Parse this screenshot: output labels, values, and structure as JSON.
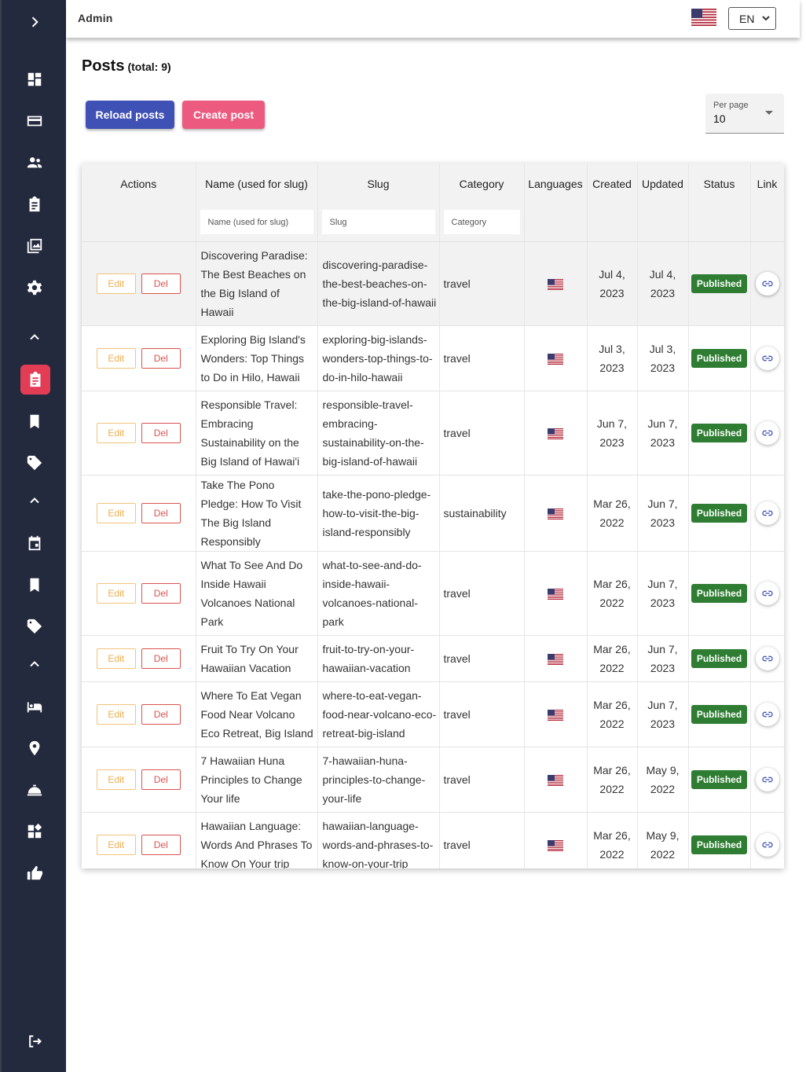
{
  "topbar": {
    "admin_label": "Admin",
    "language": "EN",
    "flag_icon": "us-flag-icon"
  },
  "sidebar": {
    "icons": [
      "chevron-right-icon",
      "dashboard-icon",
      "credit-card-icon",
      "users-icon",
      "clipboard-icon",
      "photo-library-icon",
      "settings-icon",
      "chevron-up-icon",
      "posts-icon",
      "bookmark-icon",
      "tag-icon",
      "chevron-up-icon",
      "calendar-icon",
      "bookmark-icon",
      "tag-icon",
      "chevron-up-icon",
      "bed-icon",
      "location-pin-icon",
      "room-service-icon",
      "widgets-icon",
      "thumb-up-icon",
      "logout-icon"
    ],
    "active": "posts-icon"
  },
  "page": {
    "title": "Posts",
    "total": "(total: 9)",
    "reload_label": "Reload posts",
    "create_label": "Create post",
    "per_page_label": "Per page",
    "per_page_value": "10"
  },
  "table": {
    "headers": {
      "actions": "Actions",
      "name": "Name (used for slug)",
      "slug": "Slug",
      "category": "Category",
      "languages": "Languages",
      "created": "Created",
      "updated": "Updated",
      "status": "Status",
      "link": "Link"
    },
    "filters": {
      "name": "Name (used for slug)",
      "slug": "Slug",
      "category": "Category"
    },
    "edit_label": "Edit",
    "del_label": "Del",
    "rows": [
      {
        "name": "Discovering Paradise: The Best Beaches on the Big Island of Hawaii",
        "slug": "discovering-paradise-the-best-beaches-on-the-big-island-of-hawaii",
        "category": "travel",
        "created_1": "Jul 4,",
        "created_2": "2023",
        "updated_1": "Jul 4,",
        "updated_2": "2023",
        "status": "Published"
      },
      {
        "name": "Exploring Big Island's Wonders: Top Things to Do in Hilo, Hawaii",
        "slug": "exploring-big-islands-wonders-top-things-to-do-in-hilo-hawaii",
        "category": "travel",
        "created_1": "Jul 3,",
        "created_2": "2023",
        "updated_1": "Jul 3,",
        "updated_2": "2023",
        "status": "Published"
      },
      {
        "name": "Responsible Travel: Embracing Sustainability on the Big Island of Hawai'i",
        "slug": "responsible-travel-embracing-sustainability-on-the-big-island-of-hawaii",
        "category": "travel",
        "created_1": "Jun 7,",
        "created_2": "2023",
        "updated_1": "Jun 7,",
        "updated_2": "2023",
        "status": "Published"
      },
      {
        "name": "Take The Pono Pledge: How To Visit The Big Island Responsibly",
        "slug": "take-the-pono-pledge-how-to-visit-the-big-island-responsibly",
        "category": "sustainability",
        "created_1": "Mar 26,",
        "created_2": "2022",
        "updated_1": "Jun 7,",
        "updated_2": "2023",
        "status": "Published"
      },
      {
        "name": "What To See And Do Inside Hawaii Volcanoes National Park",
        "slug": "what-to-see-and-do-inside-hawaii-volcanoes-national-park",
        "category": "travel",
        "created_1": "Mar 26,",
        "created_2": "2022",
        "updated_1": "Jun 7,",
        "updated_2": "2023",
        "status": "Published"
      },
      {
        "name": "Fruit To Try On Your Hawaiian Vacation",
        "slug": "fruit-to-try-on-your-hawaiian-vacation",
        "category": "travel",
        "created_1": "Mar 26,",
        "created_2": "2022",
        "updated_1": "Jun 7,",
        "updated_2": "2023",
        "status": "Published"
      },
      {
        "name": "Where To Eat Vegan Food Near Volcano Eco Retreat, Big Island",
        "slug": "where-to-eat-vegan-food-near-volcano-eco-retreat-big-island",
        "category": "travel",
        "created_1": "Mar 26,",
        "created_2": "2022",
        "updated_1": "Jun 7,",
        "updated_2": "2023",
        "status": "Published"
      },
      {
        "name": "7 Hawaiian Huna Principles to Change Your life",
        "slug": "7-hawaiian-huna-principles-to-change-your-life",
        "category": "travel",
        "created_1": "Mar 26,",
        "created_2": "2022",
        "updated_1": "May 9,",
        "updated_2": "2022",
        "status": "Published"
      },
      {
        "name": "Hawaiian Language: Words And Phrases To Know On Your trip",
        "slug": "hawaiian-language-words-and-phrases-to-know-on-your-trip",
        "category": "travel",
        "created_1": "Mar 26,",
        "created_2": "2022",
        "updated_1": "May 9,",
        "updated_2": "2022",
        "status": "Published"
      }
    ]
  },
  "colors": {
    "sidebar_bg": "#242a3e",
    "active": "#e23d55",
    "reload": "#3f51b5",
    "create": "#ec5a80",
    "published": "#2e7d32",
    "edit": "#f0ad4e",
    "del": "#d9534f"
  }
}
